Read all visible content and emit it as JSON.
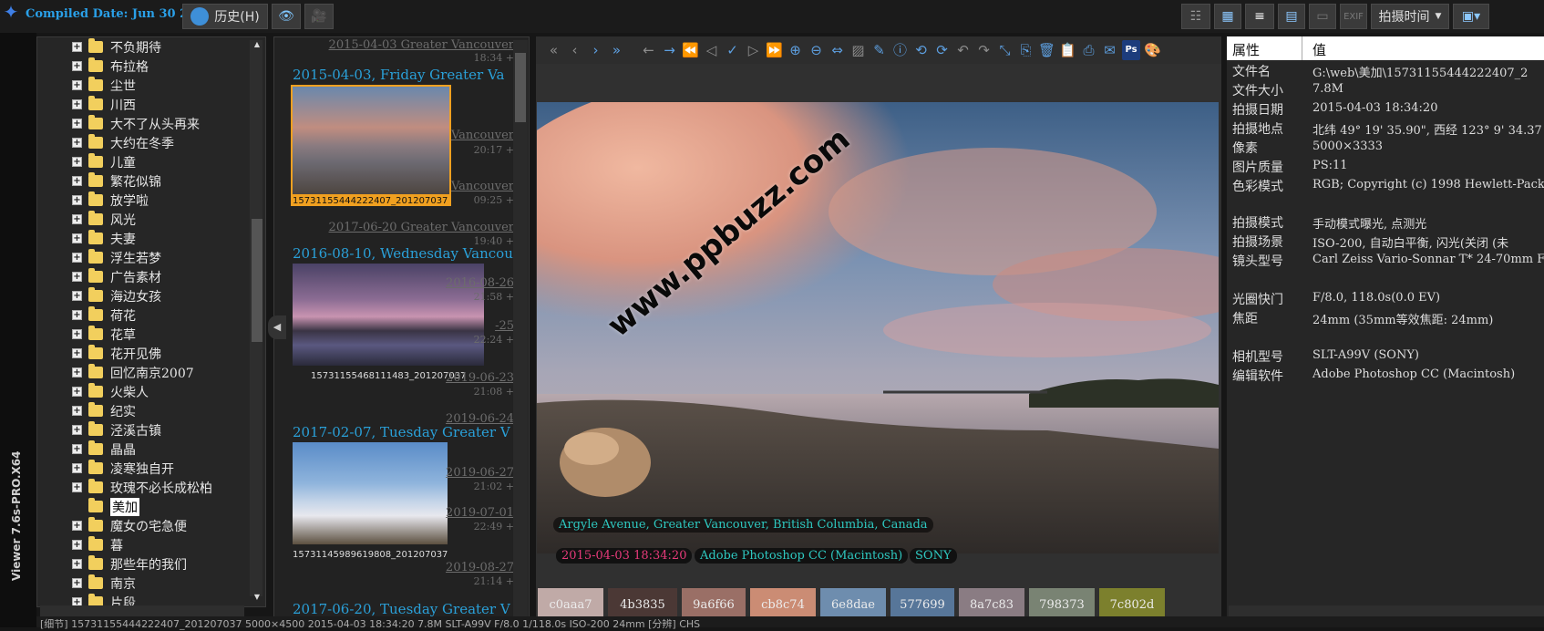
{
  "app": {
    "compiled_label": "Compiled Date: Jun 30 2:2",
    "history_label": "历史(H)",
    "vertical_title": "Viewer 7.6s-PRO.X64",
    "sort_label": "拍摄时间"
  },
  "tree": {
    "items": [
      "不负期待",
      "布拉格",
      "尘世",
      "川西",
      "大不了从头再来",
      "大约在冬季",
      "儿童",
      "繁花似锦",
      "放学啦",
      "风光",
      "夫妻",
      "浮生若梦",
      "广告素材",
      "海边女孩",
      "荷花",
      "花草",
      "花开见佛",
      "回忆南京2007",
      "火柴人",
      "纪实",
      "泾溪古镇",
      "晶晶",
      "凌寒独自开",
      "玫瑰不必长成松柏",
      "美加",
      "魔女の宅急便",
      "暮",
      "那些年的我们",
      "南京",
      "片段"
    ],
    "selected": "美加"
  },
  "thumbs": {
    "groups": [
      {
        "sub": "2015-04-03 Greater Vancouver",
        "time": "18:34 +",
        "head": "2015-04-03, Friday  Greater Va",
        "caption": "15731155444222407_201207037"
      },
      {
        "sub": "2017-06-20 Greater Vancouver",
        "time": "19:40 +",
        "head": "2016-08-10, Wednesday  Vancou",
        "caption": "15731155468111483_201207037"
      },
      {
        "sub": "2019-06-24",
        "time": "21:02 +",
        "head": "2017-02-07, Tuesday  Greater V",
        "caption": "15731145989619808_201207037"
      },
      {
        "sub": "2019-08-27",
        "time": "21:14 +",
        "head": "2017-06-20, Tuesday  Greater V",
        "caption": ""
      }
    ],
    "extra_subs": [
      "Vancouver",
      "Vancouver",
      "2016-08-26",
      "2019-06-23",
      "2019-06-27",
      "2019-07-01"
    ],
    "extra_times": [
      "20:17 +",
      "09:25 +",
      "21:58 +",
      "22:24 +",
      "21:08 +",
      "22:49 +"
    ],
    "extra_nums": [
      "-25"
    ]
  },
  "photo": {
    "watermark": "www.ppbuzz.com",
    "location_label": "Argyle Avenue, Greater Vancouver, British Columbia, Canada",
    "date_label": "2015-04-03 18:34:20",
    "software_label": "Adobe Photoshop CC (Macintosh)",
    "camera_label": "SONY"
  },
  "swatches": [
    {
      "hex": "c0aaa7",
      "color": "#c0aaa7"
    },
    {
      "hex": "4b3835",
      "color": "#4b3835"
    },
    {
      "hex": "9a6f66",
      "color": "#9a6f66"
    },
    {
      "hex": "cb8c74",
      "color": "#cb8c74"
    },
    {
      "hex": "6e8dae",
      "color": "#6e8dae"
    },
    {
      "hex": "577699",
      "color": "#577699"
    },
    {
      "hex": "8a7c83",
      "color": "#8a7c83"
    },
    {
      "hex": "798373",
      "color": "#798373"
    },
    {
      "hex": "7c802d",
      "color": "#7c802d"
    }
  ],
  "props": {
    "header_key": "属性",
    "header_val": "值",
    "rows": [
      {
        "k": "文件名",
        "v": "G:\\web\\美加\\15731155444222407_2"
      },
      {
        "k": "文件大小",
        "v": "7.8M"
      },
      {
        "k": "拍摄日期",
        "v": "2015-04-03 18:34:20"
      },
      {
        "k": "拍摄地点",
        "v": "北纬 49° 19' 35.90\", 西经 123° 9' 34.37"
      },
      {
        "k": "像素",
        "v": "5000×3333"
      },
      {
        "k": "图片质量",
        "v": "PS:11"
      },
      {
        "k": "色彩模式",
        "v": "RGB; Copyright (c) 1998 Hewlett-Packa"
      },
      {
        "k": "拍摄模式",
        "v": "手动模式曝光, 点测光"
      },
      {
        "k": "拍摄场景",
        "v": "ISO-200, 自动白平衡, 闪光(关闭 (未"
      },
      {
        "k": "镜头型号",
        "v": "Carl Zeiss Vario-Sonnar T* 24-70mm F"
      },
      {
        "k": "光圈快门",
        "v": "F/8.0, 118.0s(0.0 EV)"
      },
      {
        "k": "焦距",
        "v": "24mm (35mm等效焦距: 24mm)"
      },
      {
        "k": "相机型号",
        "v": "SLT-A99V (SONY)"
      },
      {
        "k": "编辑软件",
        "v": "Adobe Photoshop CC (Macintosh)"
      }
    ]
  },
  "status": {
    "text": "[细节] 15731155444222407_201207037    5000×4500  2015-04-03 18:34:20  7.8M  SLT-A99V  F/8.0  1/118.0s  ISO-200  24mm                    [分辨] CHS"
  }
}
